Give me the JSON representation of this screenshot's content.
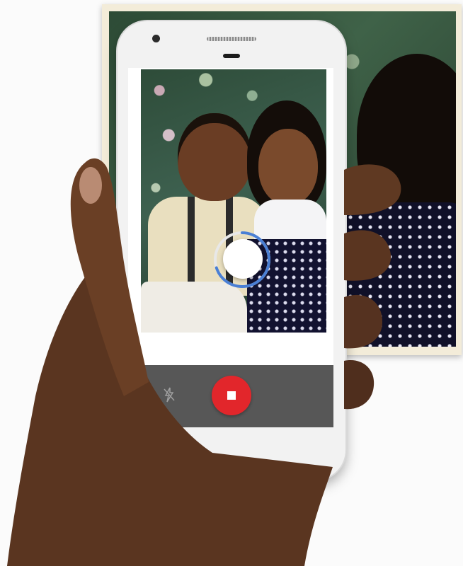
{
  "scene": {
    "photo_print": {
      "subject": "children-portrait"
    },
    "phone": {
      "viewfinder": {
        "scan_progress_percent": 70
      },
      "controls": {
        "flash_icon": "flash-off-icon",
        "shutter_icon": "stop-icon",
        "shutter_color": "#e2262b",
        "controls_bar_color": "#575757",
        "focus_ring_color": "#4a7fd4"
      }
    }
  }
}
